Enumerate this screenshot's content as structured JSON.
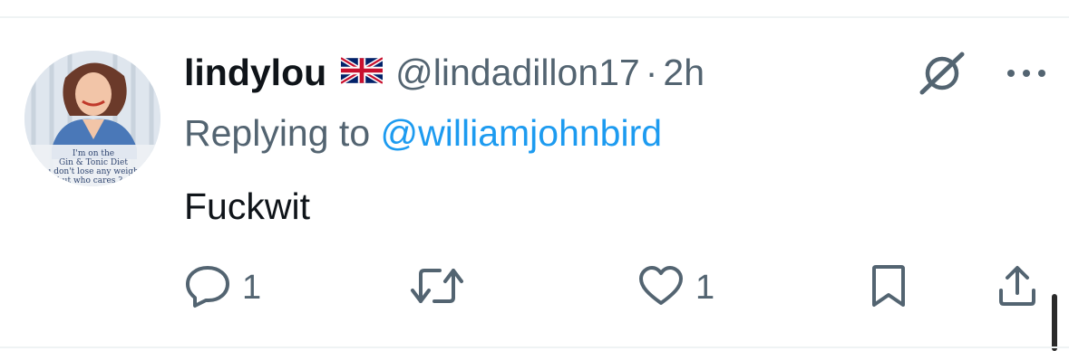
{
  "tweet": {
    "display_name": "lindylou",
    "handle": "@lindadillon17",
    "separator": "·",
    "time": "2h",
    "replying_prefix": "Replying to",
    "replying_to": "@williamjohnbird",
    "text": "Fuckwit"
  },
  "avatar": {
    "caption_lines": [
      "I'm on the",
      "Gin & Tonic Diet",
      "ou don't lose any weigh",
      "but who cares ?"
    ]
  },
  "actions": {
    "reply_count": "1",
    "retweet_count": "",
    "like_count": "1"
  },
  "icons": {
    "flag": "uk-flag-icon",
    "grok": "grok-icon",
    "more": "more-horizontal-icon",
    "reply": "reply-icon",
    "retweet": "retweet-icon",
    "like": "heart-icon",
    "bookmark": "bookmark-icon",
    "share": "share-icon"
  },
  "colors": {
    "text_primary": "#0f1419",
    "text_secondary": "#536471",
    "link": "#1d9bf0"
  }
}
